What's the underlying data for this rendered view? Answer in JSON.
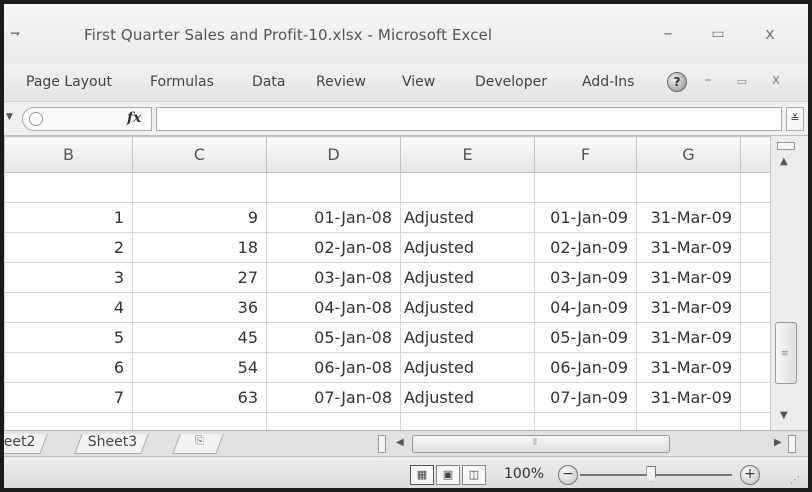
{
  "window": {
    "title": "First Quarter Sales and Profit-10.xlsx - Microsoft Excel",
    "qa_arrow": "⇁",
    "minimize": "–",
    "maximize": "▭",
    "close": "x"
  },
  "ribbon": {
    "tabs": [
      "Page Layout",
      "Formulas",
      "Data",
      "Review",
      "View",
      "Developer",
      "Add-Ins"
    ],
    "help": "?",
    "minimize": "–",
    "restore": "▭",
    "close": "x"
  },
  "formula_bar": {
    "fx_label": "fx",
    "value": "",
    "expand": "≚"
  },
  "grid": {
    "columns": [
      "B",
      "C",
      "D",
      "E",
      "F",
      "G",
      ""
    ],
    "rows": [
      [
        "",
        "",
        "",
        "",
        "",
        "",
        ""
      ],
      [
        "1",
        "9",
        "01-Jan-08",
        "Adjusted",
        "01-Jan-09",
        "31-Mar-09",
        ""
      ],
      [
        "2",
        "18",
        "02-Jan-08",
        "Adjusted",
        "02-Jan-09",
        "31-Mar-09",
        ""
      ],
      [
        "3",
        "27",
        "03-Jan-08",
        "Adjusted",
        "03-Jan-09",
        "31-Mar-09",
        ""
      ],
      [
        "4",
        "36",
        "04-Jan-08",
        "Adjusted",
        "04-Jan-09",
        "31-Mar-09",
        ""
      ],
      [
        "5",
        "45",
        "05-Jan-08",
        "Adjusted",
        "05-Jan-09",
        "31-Mar-09",
        ""
      ],
      [
        "6",
        "54",
        "06-Jan-08",
        "Adjusted",
        "06-Jan-09",
        "31-Mar-09",
        ""
      ],
      [
        "7",
        "63",
        "07-Jan-08",
        "Adjusted",
        "07-Jan-09",
        "31-Mar-09",
        ""
      ],
      [
        "",
        "",
        "",
        "",
        "",
        "",
        ""
      ]
    ]
  },
  "sheets": {
    "tabs": [
      "eet2",
      "Sheet3"
    ],
    "new_sheet": "⎘"
  },
  "status": {
    "view_icons": [
      "▦",
      "▣",
      "◫"
    ],
    "zoom": "100%",
    "zoom_out": "−",
    "zoom_in": "+",
    "zoom_level": 0.47
  }
}
